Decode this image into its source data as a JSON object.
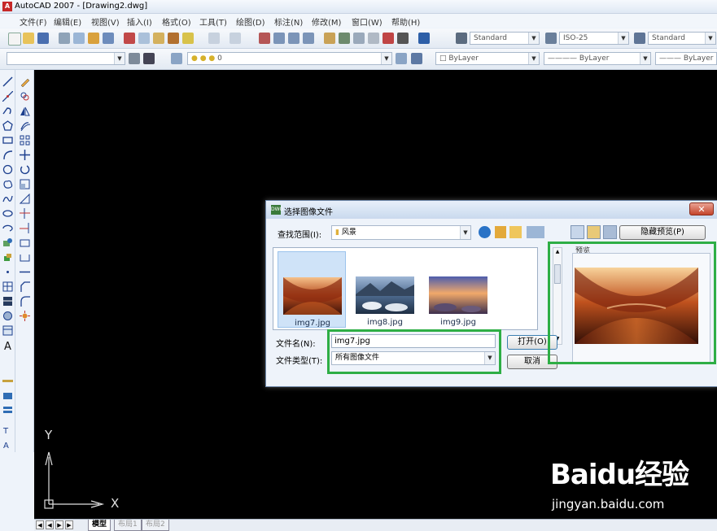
{
  "window": {
    "title": "AutoCAD 2007 - [Drawing2.dwg]",
    "app_icon_label": "A"
  },
  "menu": {
    "items": [
      {
        "label": "文件(F)"
      },
      {
        "label": "编辑(E)"
      },
      {
        "label": "视图(V)"
      },
      {
        "label": "插入(I)"
      },
      {
        "label": "格式(O)"
      },
      {
        "label": "工具(T)"
      },
      {
        "label": "绘图(D)"
      },
      {
        "label": "标注(N)"
      },
      {
        "label": "修改(M)"
      },
      {
        "label": "窗口(W)"
      },
      {
        "label": "帮助(H)"
      }
    ]
  },
  "styles_toolbar": {
    "text_style": "Standard",
    "dim_style": "ISO-25",
    "table_style": "Standard"
  },
  "layers_toolbar": {
    "layer_value": "0",
    "color": "ByLayer",
    "linetype": "ByLayer",
    "lineweight": "ByLayer"
  },
  "ucs": {
    "y_label": "Y",
    "x_label": "X"
  },
  "layout_tabs": {
    "tabs": [
      {
        "label": "模型",
        "active": true
      },
      {
        "label": "布局1",
        "active": false
      },
      {
        "label": "布局2",
        "active": false
      }
    ]
  },
  "dialog": {
    "title": "选择图像文件",
    "lookin_label": "查找范围(I):",
    "lookin_value": "风景",
    "hide_preview_button": "隐藏预览(P)",
    "files": [
      {
        "name": "img7.jpg",
        "selected": true
      },
      {
        "name": "img8.jpg",
        "selected": false
      },
      {
        "name": "img9.jpg",
        "selected": false
      }
    ],
    "filename_label": "文件名(N):",
    "filename_value": "img7.jpg",
    "filetype_label": "文件类型(T):",
    "filetype_value": "所有图像文件",
    "open_button": "打开(O)",
    "cancel_button": "取消",
    "preview_label": "预览"
  },
  "watermark": {
    "logo": "Baidu经验",
    "url": "jingyan.baidu.com"
  },
  "colors": {
    "canvas": "#000000",
    "highlight": "#2eae45"
  }
}
